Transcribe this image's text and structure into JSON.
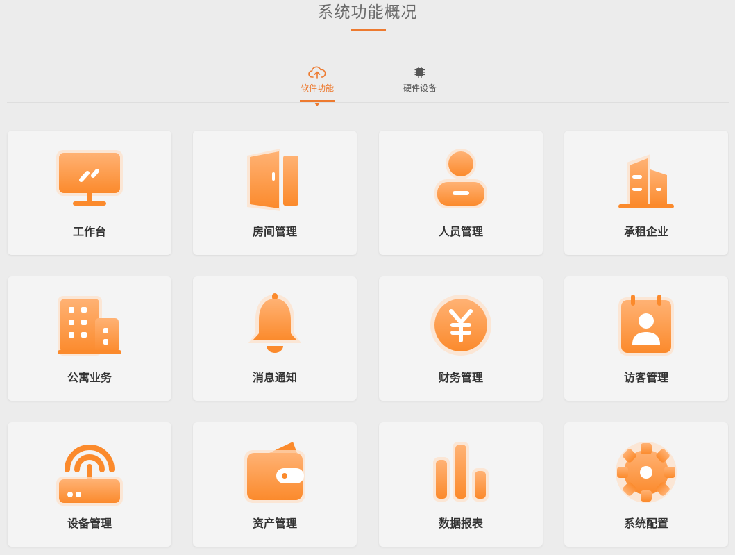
{
  "header": {
    "title": "系统功能概况"
  },
  "tabs": [
    {
      "label": "软件功能",
      "icon": "cloud-upload-icon",
      "active": true
    },
    {
      "label": "硬件设备",
      "icon": "chip-icon",
      "active": false
    }
  ],
  "colors": {
    "accent": "#ed7a2f",
    "icon_light": "#ffb274",
    "icon_dark": "#fb8a2c",
    "card_bg": "#f4f4f4",
    "page_bg": "#ececec"
  },
  "cards": [
    {
      "label": "工作台",
      "icon": "monitor-icon"
    },
    {
      "label": "房间管理",
      "icon": "door-icon"
    },
    {
      "label": "人员管理",
      "icon": "person-icon"
    },
    {
      "label": "承租企业",
      "icon": "buildings-icon"
    },
    {
      "label": "公寓业务",
      "icon": "apartment-icon"
    },
    {
      "label": "消息通知",
      "icon": "bell-icon"
    },
    {
      "label": "财务管理",
      "icon": "yuan-coin-icon"
    },
    {
      "label": "访客管理",
      "icon": "visitor-badge-icon"
    },
    {
      "label": "设备管理",
      "icon": "router-icon"
    },
    {
      "label": "资产管理",
      "icon": "wallet-icon"
    },
    {
      "label": "数据报表",
      "icon": "bar-chart-icon"
    },
    {
      "label": "系统配置",
      "icon": "gear-icon"
    }
  ]
}
